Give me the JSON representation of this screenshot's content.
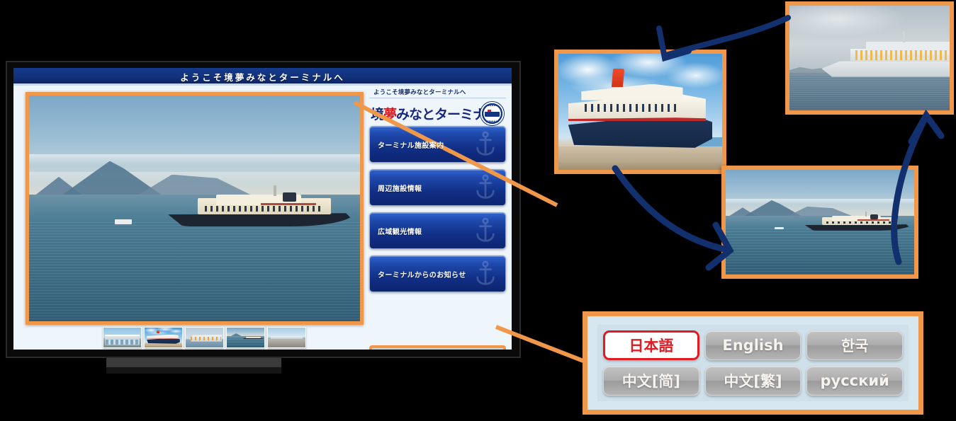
{
  "kiosk": {
    "header_title": "ようこそ境夢みなとターミナルへ",
    "breadcrumb": "ようこそ境夢みなとターミナルへ",
    "logo": {
      "text_before": "境",
      "text_accent": "夢",
      "text_after": "みなとターミナル",
      "emblem_top": "SAKAI",
      "emblem_bottom": "TERMINAL",
      "emblem_name": "port-emblem-icon"
    },
    "menu_items": [
      {
        "label": "ターミナル施設案内",
        "icon": "anchor-icon"
      },
      {
        "label": "周辺施設情報",
        "icon": "anchor-icon"
      },
      {
        "label": "広域観光情報",
        "icon": "anchor-icon"
      },
      {
        "label": "ターミナルからのお知らせ",
        "icon": "anchor-icon"
      }
    ],
    "thumbnails": [
      {
        "name": "thumb-terminal-building"
      },
      {
        "name": "thumb-cruise-ship-blue-hull"
      },
      {
        "name": "thumb-white-cruise-liner"
      },
      {
        "name": "thumb-ship-with-mountains"
      },
      {
        "name": "thumb-pier-view"
      }
    ],
    "main_photo_name": "ship-at-sea-with-mountains-photo"
  },
  "languages": [
    {
      "label": "日本語",
      "selected": true,
      "name": "lang-japanese"
    },
    {
      "label": "English",
      "selected": false,
      "name": "lang-english"
    },
    {
      "label": "한국",
      "selected": false,
      "name": "lang-korean"
    },
    {
      "label": "中文[简]",
      "selected": false,
      "name": "lang-chinese-simplified"
    },
    {
      "label": "中文[繁]",
      "selected": false,
      "name": "lang-chinese-traditional"
    },
    {
      "label": "русский",
      "selected": false,
      "name": "lang-russian"
    }
  ],
  "callouts": {
    "dock_photo": "nippon-maru-docked-photo",
    "dusk_photo": "white-cruise-liner-at-dusk-photo",
    "sea_photo": "ship-at-sea-with-mountains-photo",
    "language_panel": "language-selector-callout"
  },
  "colors": {
    "accent_orange": "#f0974a",
    "header_navy": "#143a8c",
    "arrow_navy": "#13306e",
    "selected_red": "#e11b22",
    "page_background": "#000000"
  }
}
